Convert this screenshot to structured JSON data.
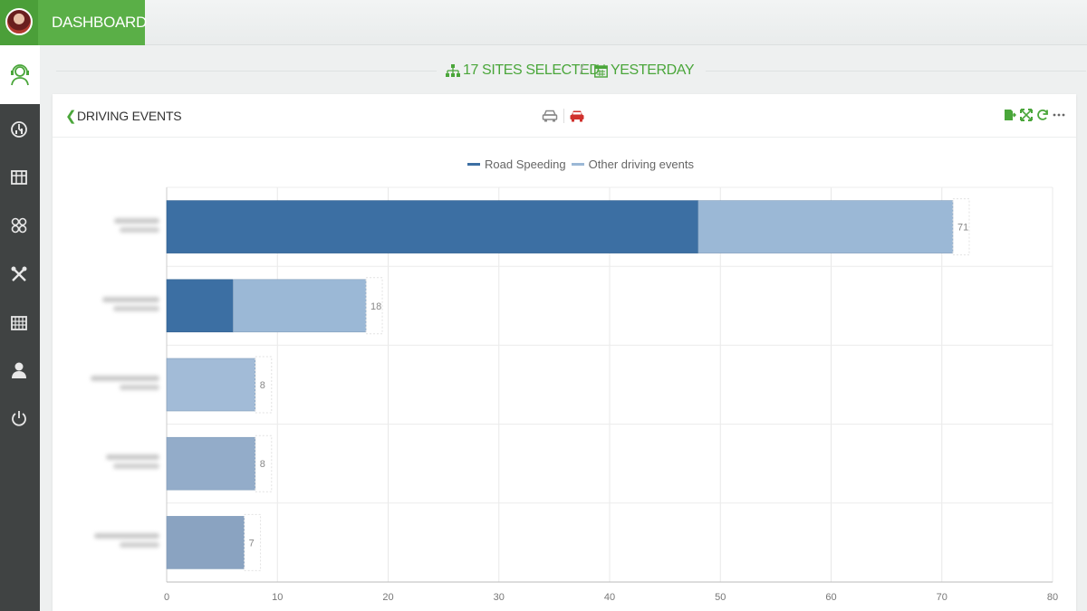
{
  "header": {
    "breadcrumb": "DASHBOARD"
  },
  "filters": {
    "sites": "17 SITES SELECTED",
    "separator": "/",
    "date": "YESTERDAY"
  },
  "card": {
    "title": "DRIVING EVENTS"
  },
  "colors": {
    "accent": "#4aa63a",
    "road_speeding": "#3c6fa3",
    "other_events": "#9bb8d6",
    "alert": "#d0312d"
  },
  "chart_data": {
    "type": "bar",
    "orientation": "horizontal",
    "stacked": true,
    "categories": [
      "",
      "",
      "",
      "",
      ""
    ],
    "series": [
      {
        "name": "Road Speeding",
        "values": [
          48,
          6,
          0,
          0,
          0
        ]
      },
      {
        "name": "Other driving events",
        "values": [
          23,
          12,
          8,
          8,
          7
        ]
      }
    ],
    "totals": [
      71,
      18,
      8,
      8,
      7
    ],
    "xlim": [
      0,
      80
    ],
    "xticks": [
      0,
      10,
      20,
      30,
      40,
      50,
      60,
      70,
      80
    ],
    "grid": true,
    "legend": "top-center"
  }
}
